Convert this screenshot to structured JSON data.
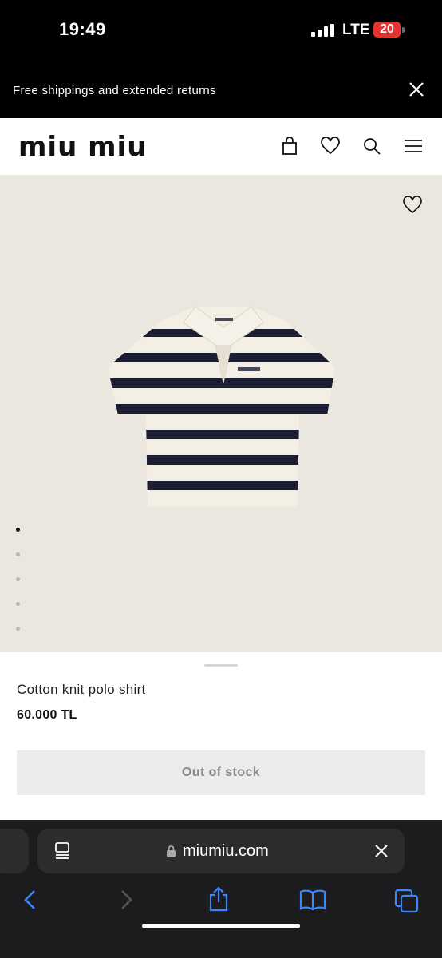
{
  "status_bar": {
    "time": "19:49",
    "network": "LTE",
    "battery": "20"
  },
  "promo_banner": {
    "text": "Free shippings and extended returns"
  },
  "header": {
    "logo": "miu miu",
    "icons": [
      "bag-icon",
      "heart-icon",
      "search-icon",
      "menu-icon"
    ]
  },
  "gallery": {
    "image_count": 5,
    "active_index": 0,
    "favorite_icon": "heart-icon"
  },
  "product": {
    "name": "Cotton knit polo shirt",
    "price": "60.000 TL",
    "cta": "Out of stock"
  },
  "browser": {
    "url": "miumiu.com",
    "toolbar_icons": [
      "back-icon",
      "forward-icon",
      "share-icon",
      "bookmarks-icon",
      "tabs-icon"
    ]
  },
  "colors": {
    "accent": "#111111",
    "hero_background": "#ebe7df",
    "button_disabled": "#ebebeb",
    "battery_low": "#e5332f"
  }
}
